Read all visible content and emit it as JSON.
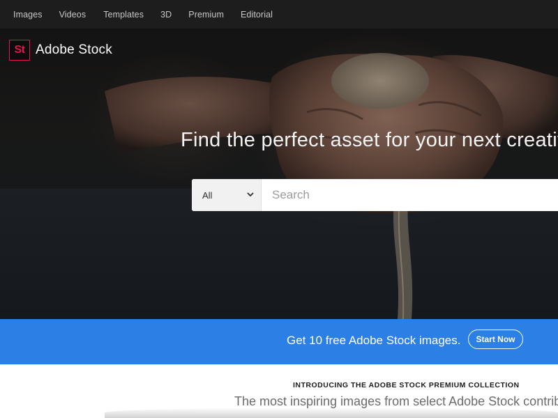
{
  "nav": {
    "items": [
      {
        "label": "Images"
      },
      {
        "label": "Videos"
      },
      {
        "label": "Templates"
      },
      {
        "label": "3D"
      },
      {
        "label": "Premium"
      },
      {
        "label": "Editorial"
      }
    ]
  },
  "brand": {
    "mark": "St",
    "name": "Adobe Stock",
    "accent_color": "#e8124f"
  },
  "hero": {
    "headline": "Find the perfect asset for your next creative"
  },
  "search": {
    "category_selected": "All",
    "placeholder": "Search"
  },
  "promo": {
    "text": "Get 10 free Adobe Stock images.",
    "button_label": "Start Now",
    "color": "#2c7fe4"
  },
  "premium": {
    "kicker": "INTRODUCING THE ADOBE STOCK PREMIUM COLLECTION",
    "subtitle": "The most inspiring images from select Adobe Stock contribut"
  },
  "icons": {
    "select_chevron": "chevron-down-icon"
  }
}
